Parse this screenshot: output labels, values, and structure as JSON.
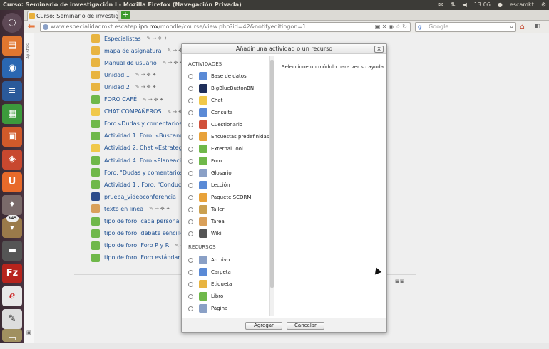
{
  "system": {
    "window_title": "Curso: Seminario de investigación I - Mozilla Firefox (Navegación Privada)",
    "time": "13:06",
    "user": "escamkt"
  },
  "launcher": {
    "badge": "345"
  },
  "browser": {
    "tab_label": "Curso: Seminario de investigac...",
    "url_prefix": "www.especialidadmkt.escatep.",
    "url_domain": "ipn.mx",
    "url_path": "/moodle/course/view.php?id=42&notifyeditingon=1",
    "search_placeholder": "Google"
  },
  "sidebar": {
    "label": "Ajustes"
  },
  "course_items": [
    {
      "label": "Especialistas",
      "icon": "file-icon",
      "color": "#e8b440"
    },
    {
      "label": "mapa de asignatura",
      "icon": "file-icon",
      "color": "#e8b440"
    },
    {
      "label": "Manual de usuario",
      "icon": "file-icon",
      "color": "#e8b440"
    },
    {
      "label": "Unidad 1",
      "icon": "file-icon",
      "color": "#e8b440"
    },
    {
      "label": "Unidad 2",
      "icon": "file-icon",
      "color": "#e8b440"
    },
    {
      "label": "FORO CAFÉ",
      "icon": "forum-icon",
      "color": "#6fb84a"
    },
    {
      "label": "CHAT COMPAÑEROS",
      "icon": "chat-icon",
      "color": "#f0c84a"
    },
    {
      "label": "Foro.«Dudas y comentarios»",
      "icon": "forum-icon",
      "color": "#6fb84a"
    },
    {
      "label": "Actividad 1. Foro: «Buscando e",
      "icon": "forum-icon",
      "color": "#6fb84a"
    },
    {
      "label": "Actividad 2. Chat «Estrategias p",
      "icon": "chat-icon",
      "color": "#f0c84a"
    },
    {
      "label": "Actividad 4. Foro «Planeación d",
      "icon": "forum-icon",
      "color": "#6fb84a"
    },
    {
      "label": "Foro. \"Dudas y comentarios\"",
      "icon": "forum-icon",
      "color": "#6fb84a"
    },
    {
      "label": "Actividad 1 . Foro. \"Conduciend",
      "icon": "forum-icon",
      "color": "#6fb84a"
    },
    {
      "label": "prueba_videoconferencia",
      "icon": "bigbluebutton-icon",
      "color": "#2b4a8a"
    },
    {
      "label": "texto en linea",
      "icon": "user-icon",
      "color": "#d9a05a"
    },
    {
      "label": "tipo de foro: cada persona plan",
      "icon": "forum-icon",
      "color": "#6fb84a"
    },
    {
      "label": "tipo de foro: debate sencillo",
      "icon": "forum-icon",
      "color": "#6fb84a"
    },
    {
      "label": "tipo de foro: Foro P y R",
      "icon": "forum-icon",
      "color": "#6fb84a"
    },
    {
      "label": "tipo de foro: Foro estándar q ap",
      "icon": "forum-icon",
      "color": "#6fb84a"
    }
  ],
  "dialog": {
    "title": "Añadir una actividad o un recurso",
    "close_label": "X",
    "section_activities": "ACTIVIDADES",
    "activities": [
      {
        "label": "Base de datos",
        "icon": "database-icon",
        "color": "#5a8ad6"
      },
      {
        "label": "BigBlueButtonBN",
        "icon": "bigbluebutton-icon",
        "color": "#1f2f5a"
      },
      {
        "label": "Chat",
        "icon": "chat-icon",
        "color": "#f0c84a"
      },
      {
        "label": "Consulta",
        "icon": "question-icon",
        "color": "#5a8ad6"
      },
      {
        "label": "Cuestionario",
        "icon": "quiz-icon",
        "color": "#d0503a"
      },
      {
        "label": "Encuestas predefinidas",
        "icon": "survey-icon",
        "color": "#e8a23a"
      },
      {
        "label": "External Tool",
        "icon": "puzzle-icon",
        "color": "#6fb84a"
      },
      {
        "label": "Foro",
        "icon": "forum-icon",
        "color": "#6fb84a"
      },
      {
        "label": "Glosario",
        "icon": "glossary-icon",
        "color": "#8aa0c6"
      },
      {
        "label": "Lección",
        "icon": "lesson-icon",
        "color": "#5a8ad6"
      },
      {
        "label": "Paquete SCORM",
        "icon": "scorm-icon",
        "color": "#e8a23a"
      },
      {
        "label": "Taller",
        "icon": "workshop-icon",
        "color": "#caa050"
      },
      {
        "label": "Tarea",
        "icon": "assignment-icon",
        "color": "#d9a05a"
      },
      {
        "label": "Wiki",
        "icon": "wiki-icon",
        "color": "#555555"
      }
    ],
    "section_resources": "RECURSOS",
    "resources": [
      {
        "label": "Archivo",
        "icon": "file-icon",
        "color": "#8aa0c6"
      },
      {
        "label": "Carpeta",
        "icon": "folder-icon",
        "color": "#5a8ad6"
      },
      {
        "label": "Etiqueta",
        "icon": "label-icon",
        "color": "#e8b440"
      },
      {
        "label": "Libro",
        "icon": "book-icon",
        "color": "#6fb84a"
      },
      {
        "label": "Página",
        "icon": "page-icon",
        "color": "#8aa0c6"
      }
    ],
    "description": "Seleccione un módulo para ver su ayuda.",
    "add_button": "Agregar",
    "cancel_button": "Cancelar"
  }
}
